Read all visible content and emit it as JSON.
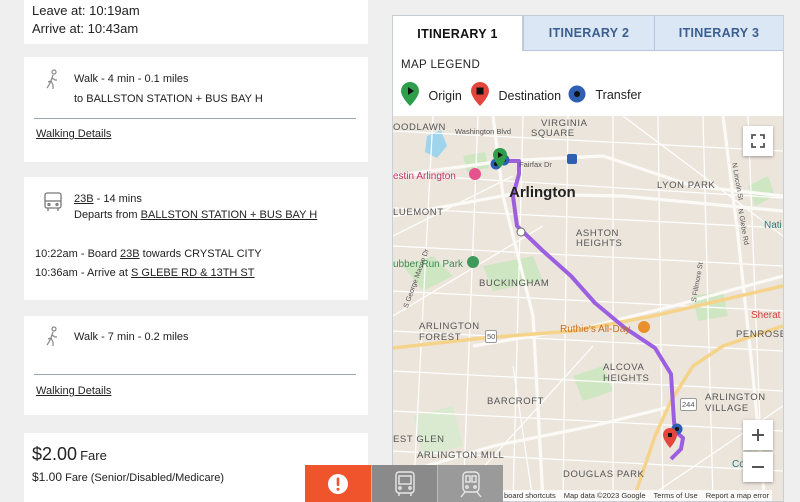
{
  "trip": {
    "leave": "Leave at: 10:19am",
    "arrive": "Arrive at: 10:43am"
  },
  "steps": [
    {
      "type": "walk",
      "summary": "Walk - 4 min - 0.1 miles",
      "to_prefix": "to ",
      "to": "BALLSTON STATION + BUS BAY H",
      "details_link": "Walking Details"
    },
    {
      "type": "bus",
      "route": "23B",
      "duration": " - 14 mins",
      "departs_prefix": "Departs from ",
      "departs_from": "BALLSTON STATION + BUS BAY H",
      "board_prefix": "10:22am - Board ",
      "board_route": "23B",
      "board_suffix": " towards CRYSTAL CITY",
      "arrive_prefix": "10:36am - Arrive at ",
      "arrive_stop": "S GLEBE RD & 13TH ST"
    },
    {
      "type": "walk",
      "summary": "Walk - 7 min - 0.2 miles",
      "details_link": "Walking Details"
    }
  ],
  "fare": {
    "amount": "$2.00",
    "label": "Fare",
    "reduced_amount": "$1.00",
    "reduced_label": "Fare (Senior/Disabled/Medicare)"
  },
  "tabs": [
    {
      "label": "ITINERARY 1",
      "active": true
    },
    {
      "label": "ITINERARY 2",
      "active": false
    },
    {
      "label": "ITINERARY 3",
      "active": false
    }
  ],
  "legend": {
    "title": "MAP LEGEND",
    "origin": "Origin",
    "destination": "Destination",
    "transfer": "Transfer",
    "origin_color": "#2e9e4a",
    "destination_color": "#e5463c",
    "transfer_color": "#2f5fb3"
  },
  "map": {
    "route_color": "#9b5fe0",
    "labels": {
      "virginia_square_1": "VIRGINIA",
      "virginia_square_2": "SQUARE",
      "oodlawn": "OODLAWN",
      "washington_blvd": "Washington Blvd",
      "fairfax_dr": "Fairfax Dr",
      "westin": "estin Arlington",
      "arlington": "Arlington",
      "lyon_park": "LYON PARK",
      "luemont": "LUEMONT",
      "ashton_1": "ASHTON",
      "ashton_2": "HEIGHTS",
      "bubber_run": "ubber Run Park",
      "buckingham": "BUCKINGHAM",
      "arlington_forest_1": "ARLINGTON",
      "arlington_forest_2": "FOREST",
      "ruthies": "Ruthie's All-Day",
      "alcova_1": "ALCOVA",
      "alcova_2": "HEIGHTS",
      "penrose": "PENROSE",
      "sherat": "Sherat",
      "nati": "Nati",
      "barcroft": "BARCROFT",
      "arlington_village_1": "ARLINGTON",
      "arlington_village_2": "VILLAGE",
      "est_glen": "EST GLEN",
      "arlington_mill": "ARLINGTON MILL",
      "douglas_park": "DOUGLAS PARK",
      "co": "Co",
      "road_50": "50",
      "road_244": "244",
      "filmore": "S Fillmore St",
      "glebe": "N Glebe Rd",
      "george_mason": "S George Mason Dr",
      "n_lincoln": "N Lincoln St"
    },
    "attribution": {
      "shortcuts": "board shortcuts",
      "data": "Map data ©2023 Google",
      "terms": "Terms of Use",
      "report": "Report a map error"
    }
  },
  "bottom_bar": {
    "alert_color": "#f0542d",
    "bus_color": "#8a8a8a",
    "train_color": "#9a9a9a"
  }
}
